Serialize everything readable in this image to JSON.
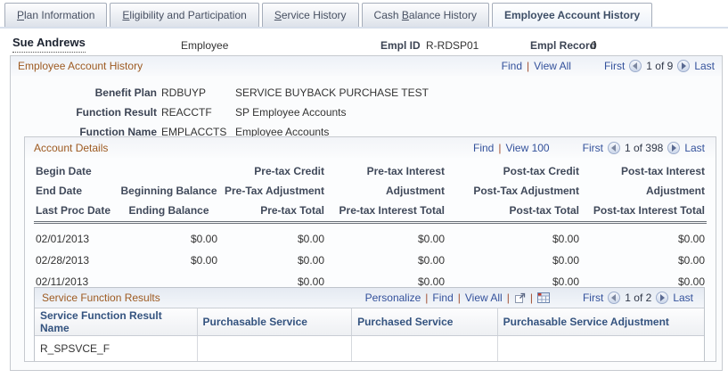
{
  "tabs": [
    {
      "pre": "",
      "key": "P",
      "post": "lan Information"
    },
    {
      "pre": "",
      "key": "E",
      "post": "ligibility and Participation"
    },
    {
      "pre": "",
      "key": "S",
      "post": "ervice History"
    },
    {
      "pre": "Cash ",
      "key": "B",
      "post": "alance History"
    },
    {
      "pre": "Employee Account History",
      "key": "",
      "post": ""
    }
  ],
  "employee": {
    "name": "Sue Andrews",
    "type": "Employee",
    "empl_id_label": "Empl ID",
    "empl_id": "R-RDSP01",
    "empl_record_label": "Empl Record",
    "empl_record": "0"
  },
  "eah": {
    "title": "Employee Account History",
    "find": "Find",
    "view_all": "View All",
    "first": "First",
    "position": "1 of 9",
    "last": "Last",
    "fields": [
      {
        "label": "Benefit Plan",
        "value": "RDBUYP",
        "desc": "SERVICE BUYBACK PURCHASE TEST"
      },
      {
        "label": "Function Result",
        "value": "REACCTF",
        "desc": "SP Employee Accounts"
      },
      {
        "label": "Function Name",
        "value": "EMPLACCTS",
        "desc": "Employee Accounts"
      }
    ]
  },
  "account_details": {
    "title": "Account Details",
    "find": "Find",
    "view": "View 100",
    "first": "First",
    "position": "1 of 398",
    "last": "Last",
    "columns": [
      {
        "l1": "Begin Date",
        "l2": "End Date",
        "l3": "Last Proc Date"
      },
      {
        "l1": "",
        "l2": "Beginning Balance",
        "l3": "Ending Balance"
      },
      {
        "l1": "Pre-tax Credit",
        "l2": "Pre-Tax Adjustment",
        "l3": "Pre-tax Total"
      },
      {
        "l1": "Pre-tax Interest",
        "l2": "Adjustment",
        "l3": "Pre-tax Interest Total"
      },
      {
        "l1": "Post-tax Credit",
        "l2": "Post-Tax Adjustment",
        "l3": "Post-tax Total"
      },
      {
        "l1": "Post-tax Interest",
        "l2": "Adjustment",
        "l3": "Post-tax Interest Total"
      }
    ],
    "rows": [
      [
        "02/01/2013",
        "$0.00",
        "$0.00",
        "$0.00",
        "$0.00",
        "$0.00"
      ],
      [
        "02/28/2013",
        "$0.00",
        "$0.00",
        "$0.00",
        "$0.00",
        "$0.00"
      ],
      [
        "02/11/2013",
        "",
        "$0.00",
        "$0.00",
        "$0.00",
        "$0.00"
      ]
    ]
  },
  "service_results": {
    "title": "Service Function Results",
    "personalize": "Personalize",
    "find": "Find",
    "view_all": "View All",
    "first": "First",
    "position": "1 of 2",
    "last": "Last",
    "headers": [
      "Service Function Result Name",
      "Purchasable Service",
      "Purchased Service",
      "Purchasable Service Adjustment"
    ],
    "rows": [
      [
        "R_SPSVCE_F",
        "",
        "",
        ""
      ]
    ]
  },
  "colors": {
    "section_title": "#9d5a21",
    "link": "#33519b",
    "pipe_separator": "#a14f32",
    "grid_header_text": "#34537f",
    "tab_underline": "#d7dfeb"
  }
}
